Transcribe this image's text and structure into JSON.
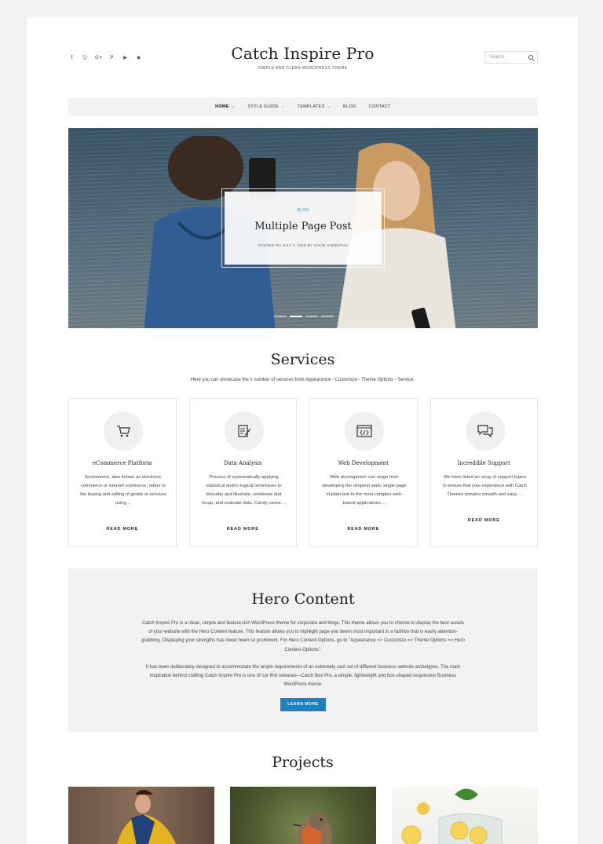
{
  "header": {
    "site_title": "Catch Inspire Pro",
    "tagline": "SIMPLE AND CLEAN WORDPRESS THEME",
    "search_placeholder": "Search",
    "social_icons": [
      "facebook-icon",
      "twitter-icon",
      "googleplus-icon",
      "pinterest-icon",
      "youtube-icon",
      "instagram-icon"
    ]
  },
  "nav": {
    "items": [
      {
        "label": "HOME",
        "has_dropdown": true
      },
      {
        "label": "STYLE GUIDE",
        "has_dropdown": true
      },
      {
        "label": "TEMPLATES",
        "has_dropdown": true
      },
      {
        "label": "BLOG",
        "has_dropdown": false
      },
      {
        "label": "CONTACT",
        "has_dropdown": false
      }
    ]
  },
  "slider": {
    "category": "BLOG",
    "title": "Multiple Page Post",
    "meta": "POSTED ON JULY 2, 2018  BY SAKIN SHRESTHA"
  },
  "services": {
    "title": "Services",
    "description": "Here you can showcase the x number of services from Appearance - Customize - Theme Options - Service.",
    "items": [
      {
        "icon": "cart-icon",
        "title": "eCommerce Platform",
        "text": "Ecommerce, also known as electronic commerce or internet commerce, refers to the buying and selling of goods or services using ...",
        "more": "READ MORE"
      },
      {
        "icon": "document-edit-icon",
        "title": "Data Analysis",
        "text": "Process of systematically applying statistical and/or logical techniques to describe and illustrate, condense and recap, and evaluate data. Candy canes ...",
        "more": "READ MORE"
      },
      {
        "icon": "code-window-icon",
        "title": "Web Development",
        "text": "Web development can range from developing the simplest static single page of plain text to the most complex web-based applications ...",
        "more": "READ MORE"
      },
      {
        "icon": "chat-bubbles-icon",
        "title": "Incredible Support",
        "text": "We have listed an array of support topics to ensure that your experience with Catch Themes remains smooth and easy. ...",
        "more": "READ MORE"
      }
    ]
  },
  "hero_content": {
    "title": "Hero Content",
    "paragraph_1": "Catch Inspire Pro is a clean, simple and feature-rich WordPress theme for corporate and blogs. This theme allows you to choose to display the best assets of your website with the Hero Content feature. This feature allows you to highlight page you deem most important in a fashion that is easily attention-grabbing. Displaying your strengths has never been so prominent. For Hero Content Options, go to \"Appearance => Customize => Theme Options => Hero Content Options\".",
    "paragraph_2": "It has been deliberately designed to accommodate the ample requirements of an extremely vast set of different business website archetypes. The main inspiration behind crafting Catch Inspire Pro is one of our first releases—Catch Box Pro, a simple, lightweight and box-shaped responsive Business WordPress theme.",
    "button": "LEARN MORE"
  },
  "projects": {
    "title": "Projects"
  },
  "colors": {
    "accent": "#1b81c0",
    "panel": "#f1f2f3"
  }
}
